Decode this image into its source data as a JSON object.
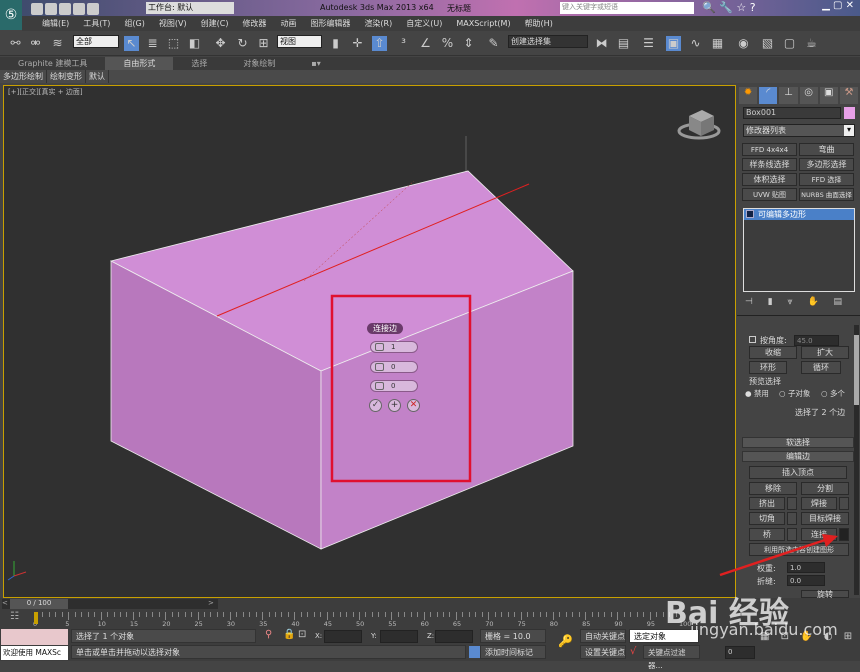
{
  "app": {
    "title": "Autodesk 3ds Max  2013 x64",
    "doc_title": "无标题",
    "workspace": "工作台: 默认",
    "search_placeholder": "键入关键字或短语"
  },
  "menu": [
    "编辑(E)",
    "工具(T)",
    "组(G)",
    "视图(V)",
    "创建(C)",
    "修改器",
    "动画",
    "图形编辑器",
    "渲染(R)",
    "自定义(U)",
    "MAXScript(M)",
    "帮助(H)"
  ],
  "toolbar": {
    "filter": "全部",
    "ref_coord": "视图",
    "named_sel": "创建选择集"
  },
  "ribbon": {
    "tabs": [
      "Graphite 建模工具",
      "自由形式",
      "选择",
      "对象绘制"
    ],
    "active": 1,
    "sub": [
      "多边形绘制",
      "绘制变形",
      "默认"
    ]
  },
  "viewport": {
    "label": "[+][正交][真实 + 边面]",
    "object_color": "#c98bd0",
    "caddy": {
      "title": "连接边",
      "segments": "1",
      "pinch": "0",
      "slide": "0"
    }
  },
  "panel": {
    "object_name": "Box001",
    "object_color": "#e8a0e8",
    "modifier_list": "修改器列表",
    "mod_buttons": [
      "FFD 4x4x4",
      "弯曲",
      "样条线选择",
      "多边形选择",
      "体积选择",
      "FFD 选择",
      "UVW 贴图",
      "NURBS 曲面选择"
    ],
    "stack_item": "可编辑多边形",
    "angle_label": "按角度:",
    "angle_value": "45.0",
    "shrink": "收缩",
    "grow": "扩大",
    "ring": "环形",
    "loop": "循环",
    "preview_label": "预览选择",
    "preview_options": [
      "禁用",
      "子对象",
      "多个"
    ],
    "preview_selected": 0,
    "sel_status": "选择了 2 个边",
    "soft_sel": "软选择",
    "edit_edges": "编辑边",
    "edge_buttons": [
      "插入顶点",
      "移除",
      "分割",
      "挤出",
      "焊接",
      "切角",
      "目标焊接",
      "桥",
      "连接",
      "利用所选内容创建图形"
    ],
    "weight_label": "权重:",
    "weight": "1.0",
    "crease_label": "折缝:",
    "crease": "0.0",
    "rotate": "旋转"
  },
  "bottom": {
    "frame": "0 / 100",
    "ticks": [
      "0",
      "5",
      "10",
      "15",
      "20",
      "25",
      "30",
      "35",
      "40",
      "45",
      "50",
      "55",
      "60",
      "65",
      "70",
      "75",
      "80",
      "85",
      "90",
      "95",
      "100"
    ],
    "welcome": "欢迎使用 MAXSc",
    "status1": "选择了 1 个对象",
    "status2": "单击或单击并拖动以选择对象",
    "x": "X:",
    "y": "Y:",
    "z": "Z:",
    "grid": "栅格 = 10.0",
    "add_tag": "添加时间标记",
    "auto_key": "自动关键点",
    "set_key": "设置关键点",
    "sel_obj": "选定对象",
    "key_filter": "关键点过滤器...",
    "frame_field": "0"
  },
  "watermark": "Bai 经验 jingyan.baidu.com"
}
